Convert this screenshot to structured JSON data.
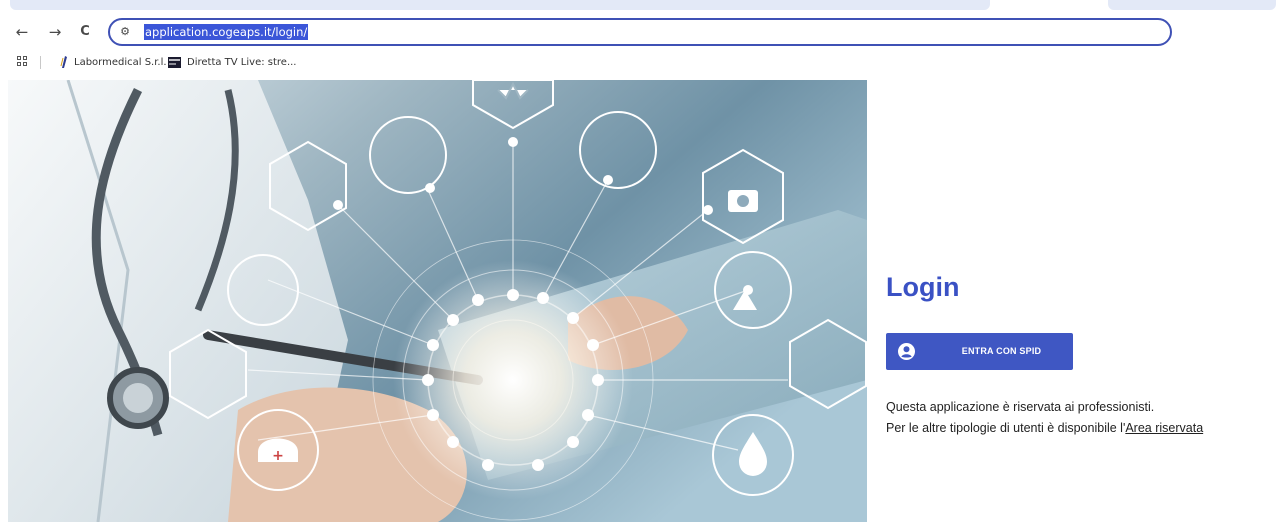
{
  "browser": {
    "url": "application.cogeaps.it/login/",
    "bookmarks": [
      {
        "label": "Labormedical S.r.l.",
        "icon": "labormedical-favicon"
      },
      {
        "label": "Diretta TV Live: stre...",
        "icon": "tv-favicon"
      }
    ],
    "icons": {
      "back": "back-arrow-icon",
      "forward": "forward-arrow-icon",
      "reload": "reload-icon",
      "site_info": "tune-icon",
      "apps": "apps-grid-icon"
    },
    "glyphs": {
      "back": "←",
      "forward": "→",
      "reload": "C",
      "site_info": "⚙"
    }
  },
  "login": {
    "title": "Login",
    "spid_button": "ENTRA CON SPID",
    "desc_line1": "Questa applicazione è riservata ai professionisti.",
    "desc_line2_prefix": "Per le altre tipologie di utenti è disponibile l'",
    "desc_link": "Area riservata"
  },
  "colors": {
    "accent": "#3f57c3",
    "title": "#3a51c4",
    "url_highlight": "#3b56d8"
  }
}
